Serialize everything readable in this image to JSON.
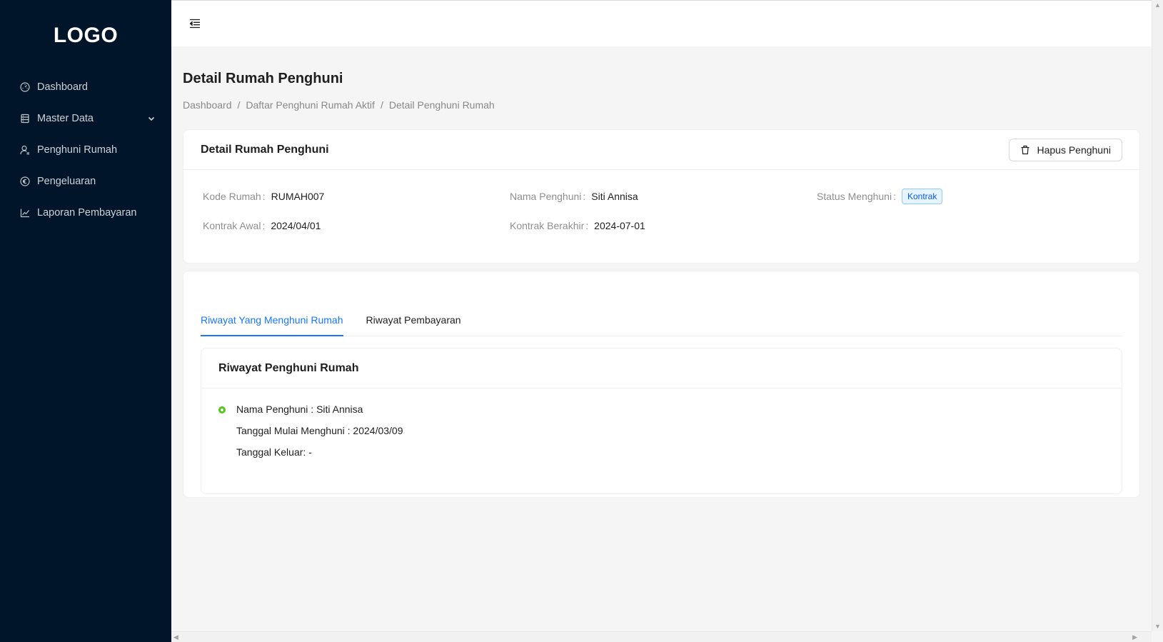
{
  "sidebar": {
    "logo": "LOGO",
    "items": [
      {
        "label": "Dashboard",
        "icon": "dashboard-icon"
      },
      {
        "label": "Master Data",
        "icon": "database-icon",
        "has_children": true
      },
      {
        "label": "Penghuni Rumah",
        "icon": "user-icon"
      },
      {
        "label": "Pengeluaran",
        "icon": "euro-circle-icon"
      },
      {
        "label": "Laporan Pembayaran",
        "icon": "line-chart-icon"
      }
    ]
  },
  "header": {
    "menu_toggle_icon": "menu-fold-icon"
  },
  "page": {
    "title": "Detail Rumah Penghuni",
    "breadcrumb": [
      "Dashboard",
      "Daftar Penghuni Rumah Aktif",
      "Detail Penghuni Rumah"
    ],
    "breadcrumb_separator": "/"
  },
  "detail_card": {
    "title": "Detail Rumah Penghuni",
    "delete_button": "Hapus Penghuni",
    "fields": {
      "kode_rumah": {
        "label": "Kode Rumah",
        "value": "RUMAH007"
      },
      "nama_penghuni": {
        "label": "Nama Penghuni",
        "value": "Siti Annisa"
      },
      "status_menghuni": {
        "label": "Status Menghuni",
        "value": "Kontrak"
      },
      "kontrak_awal": {
        "label": "Kontrak Awal",
        "value": "2024/04/01"
      },
      "kontrak_berakhir": {
        "label": "Kontrak Berakhir",
        "value": "2024-07-01"
      }
    },
    "colon": ":"
  },
  "tabs": {
    "items": [
      "Riwayat Yang Menghuni Rumah",
      "Riwayat Pembayaran"
    ],
    "active_index": 0
  },
  "history_card": {
    "title": "Riwayat Penghuni Rumah",
    "entries": [
      {
        "nama": "Nama Penghuni : Siti Annisa",
        "mulai": "Tanggal Mulai Menghuni : 2024/03/09",
        "keluar": "Tanggal Keluar: -"
      }
    ]
  },
  "colors": {
    "sidebar_bg": "#001529",
    "accent": "#1677ff",
    "tag_blue": "#0958d9",
    "timeline_green": "#52c41a"
  }
}
